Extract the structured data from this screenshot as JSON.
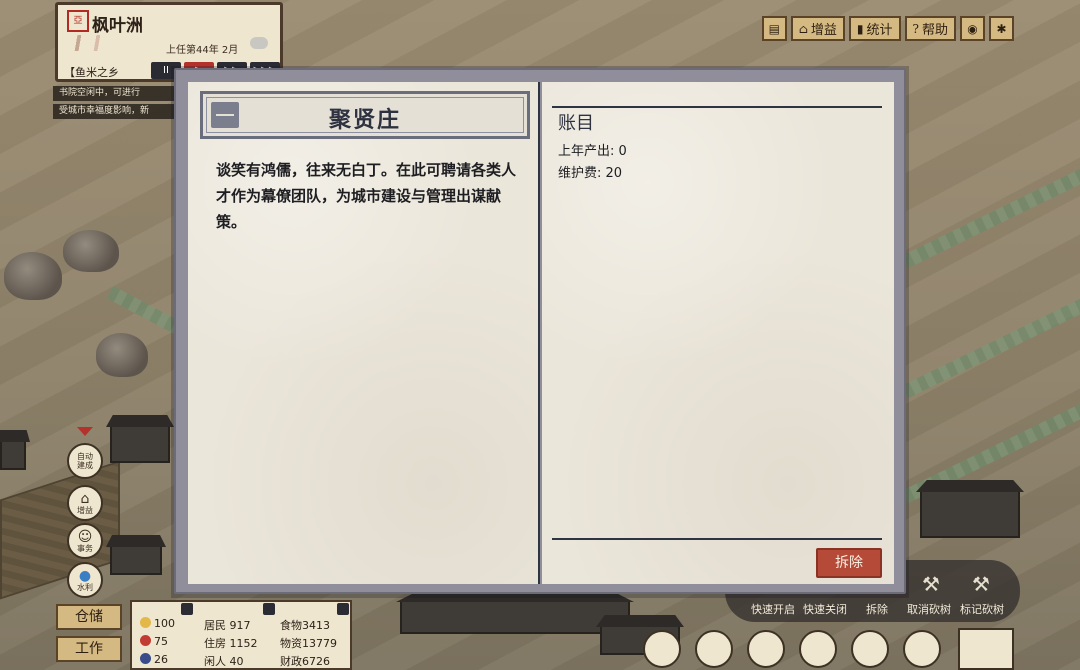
{
  "city": {
    "seal": "亞",
    "name": "枫叶洲",
    "date": "上任第44年 2月",
    "title": "【鱼米之乡",
    "speed_buttons": [
      "II",
      "▶",
      "▶▶",
      "▶▶▶"
    ]
  },
  "notices": [
    "书院空闲中，可进行",
    "受城市幸福度影响，新"
  ],
  "toolbar": {
    "book_label": "",
    "gain_label": "增益",
    "stats_label": "统计",
    "help_label": "帮助"
  },
  "side_buttons": [
    {
      "label": "自动\n建成",
      "icon": "auto-build-icon"
    },
    {
      "label": "增益",
      "icon": "house-icon"
    },
    {
      "label": "事务",
      "icon": "person-icon"
    },
    {
      "label": "水利",
      "icon": "water-drop-icon"
    }
  ],
  "bottom_tabs": {
    "warehouse": "仓储",
    "work": "工作"
  },
  "stats": {
    "happiness": "100",
    "health": "75",
    "people": "26",
    "residents": "居民 917",
    "housing": "住房 1152",
    "idle": "闲人 40",
    "food": "食物3413",
    "goods": "物资13779",
    "finance": "财政6726"
  },
  "actions": {
    "quick_open": "快速开启",
    "quick_close": "快速关闭",
    "demolish": "拆除",
    "cancel_fell": "取消砍树",
    "mark_fell": "标记砍树"
  },
  "dialog": {
    "title": "聚贤庄",
    "description": "谈笑有鸿儒，往来无白丁。在此可聘请各类人才作为幕僚团队，为城市建设与管理出谋献策。",
    "ledger_title": "账目",
    "last_year_output": "上年产出: 0",
    "maintenance": "维护费: 20",
    "demolish_button": "拆除"
  },
  "colors": {
    "demolish_button": "#b54a38",
    "paper": "#ebe6da",
    "frame": "#8f8e9a",
    "ink": "#2e3240"
  }
}
